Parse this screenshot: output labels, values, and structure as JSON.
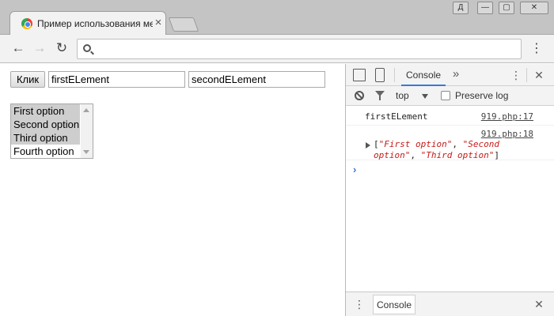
{
  "window": {
    "user_badge": "Д",
    "tab_title": "Пример использования ме",
    "tab_close": "×",
    "minimize": "—",
    "restore": "▢",
    "close": "✕"
  },
  "toolbar": {
    "back": "←",
    "forward": "→",
    "reload": "↻",
    "url": "",
    "menu": "⋮"
  },
  "page": {
    "button_label": "Клик",
    "input1_value": "firstELement",
    "input2_value": "secondELement",
    "listbox": {
      "options": [
        {
          "label": "First option",
          "selected": true
        },
        {
          "label": "Second option",
          "selected": true
        },
        {
          "label": "Third option",
          "selected": true
        },
        {
          "label": "Fourth option",
          "selected": false
        }
      ]
    }
  },
  "devtools": {
    "top_tab": "Console",
    "more_tabs": "»",
    "menu": "⋮",
    "close": "✕",
    "context": "top",
    "preserve_log": "Preserve log",
    "logs": [
      {
        "text": "firstELement",
        "source": "919.php:17"
      },
      {
        "source": "919.php:18"
      }
    ],
    "array_open": "[",
    "array_items": [
      "\"First option\"",
      "\"Second option\"",
      "\"Third option\""
    ],
    "array_sep": ", ",
    "array_close": "]",
    "prompt": "›",
    "drawer_menu": "⋮",
    "drawer_tab": "Console",
    "drawer_close": "✕"
  }
}
